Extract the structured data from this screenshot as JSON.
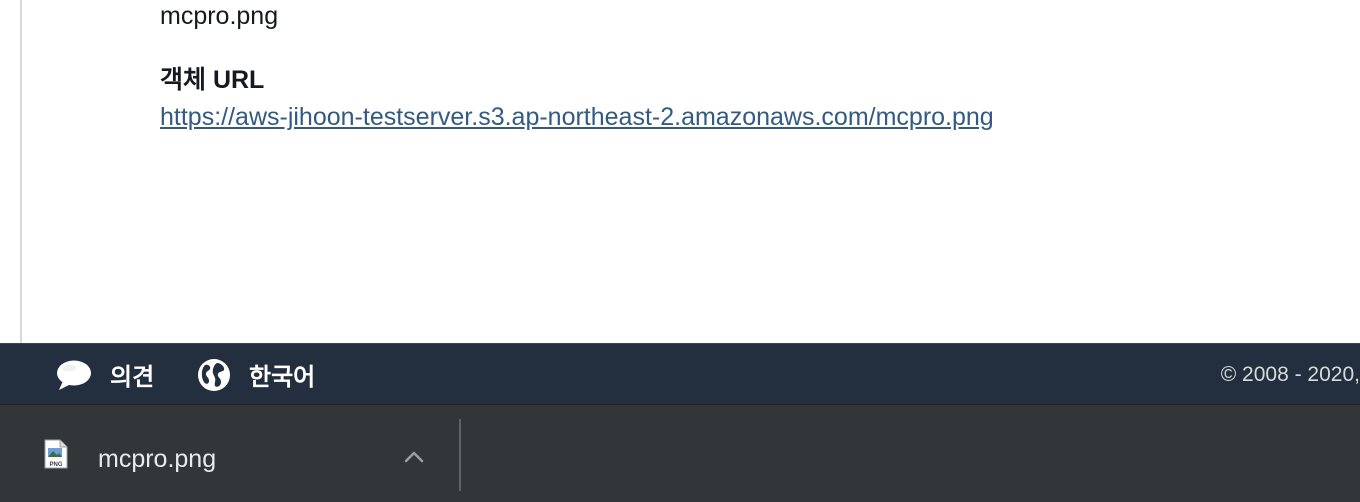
{
  "content": {
    "object_name": "mcpro.png",
    "url_label": "객체 URL",
    "url": "https://aws-jihoon-testserver.s3.ap-northeast-2.amazonaws.com/mcpro.png"
  },
  "footer": {
    "feedback_label": "의견",
    "feedback_icon": "speech-bubble-icon",
    "language_label": "한국어",
    "language_icon": "globe-icon",
    "copyright": "© 2008 - 2020,"
  },
  "download_shelf": {
    "file_name": "mcpro.png",
    "file_type_badge": "PNG",
    "file_icon": "png-file-icon",
    "expand_icon": "chevron-up-icon"
  },
  "colors": {
    "footer_bg": "#232f3e",
    "link": "#335a83",
    "shelf_bg": "#323639"
  }
}
